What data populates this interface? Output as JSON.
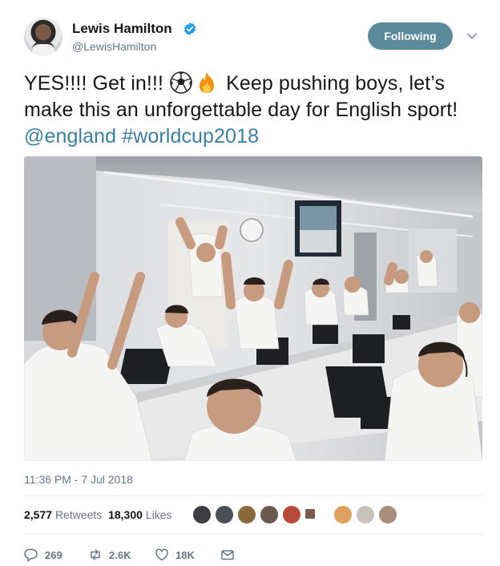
{
  "tweet": {
    "author_name": "Lewis Hamilton",
    "author_handle": "@LewisHamilton",
    "follow_label": "Following",
    "text_part1": "YES!!!! Get in!!! ",
    "text_part2": " Keep pushing boys, let’s make this an unforgettable day for English sport! ",
    "mention": "@england",
    "hashtag": "#worldcup2018",
    "timestamp": "11:36 PM - 7 Jul 2018",
    "retweets_count": "2,577",
    "retweets_label": "Retweets",
    "likes_count": "18,300",
    "likes_label": "Likes",
    "replies": "269",
    "retweets_short": "2.6K",
    "likes_short": "18K"
  },
  "icons": {
    "verified": "verified-badge-icon",
    "caret": "chevron-down-icon",
    "emoji1": "soccer-ball-icon",
    "emoji2": "fire-icon",
    "reply": "reply-icon",
    "retweet": "retweet-icon",
    "like": "heart-icon",
    "dm": "envelope-icon"
  },
  "colors": {
    "follow_button": "#5b8a9b",
    "link": "#3a7fa8",
    "verified": "#1da1f2",
    "secondary_text": "#657786"
  }
}
